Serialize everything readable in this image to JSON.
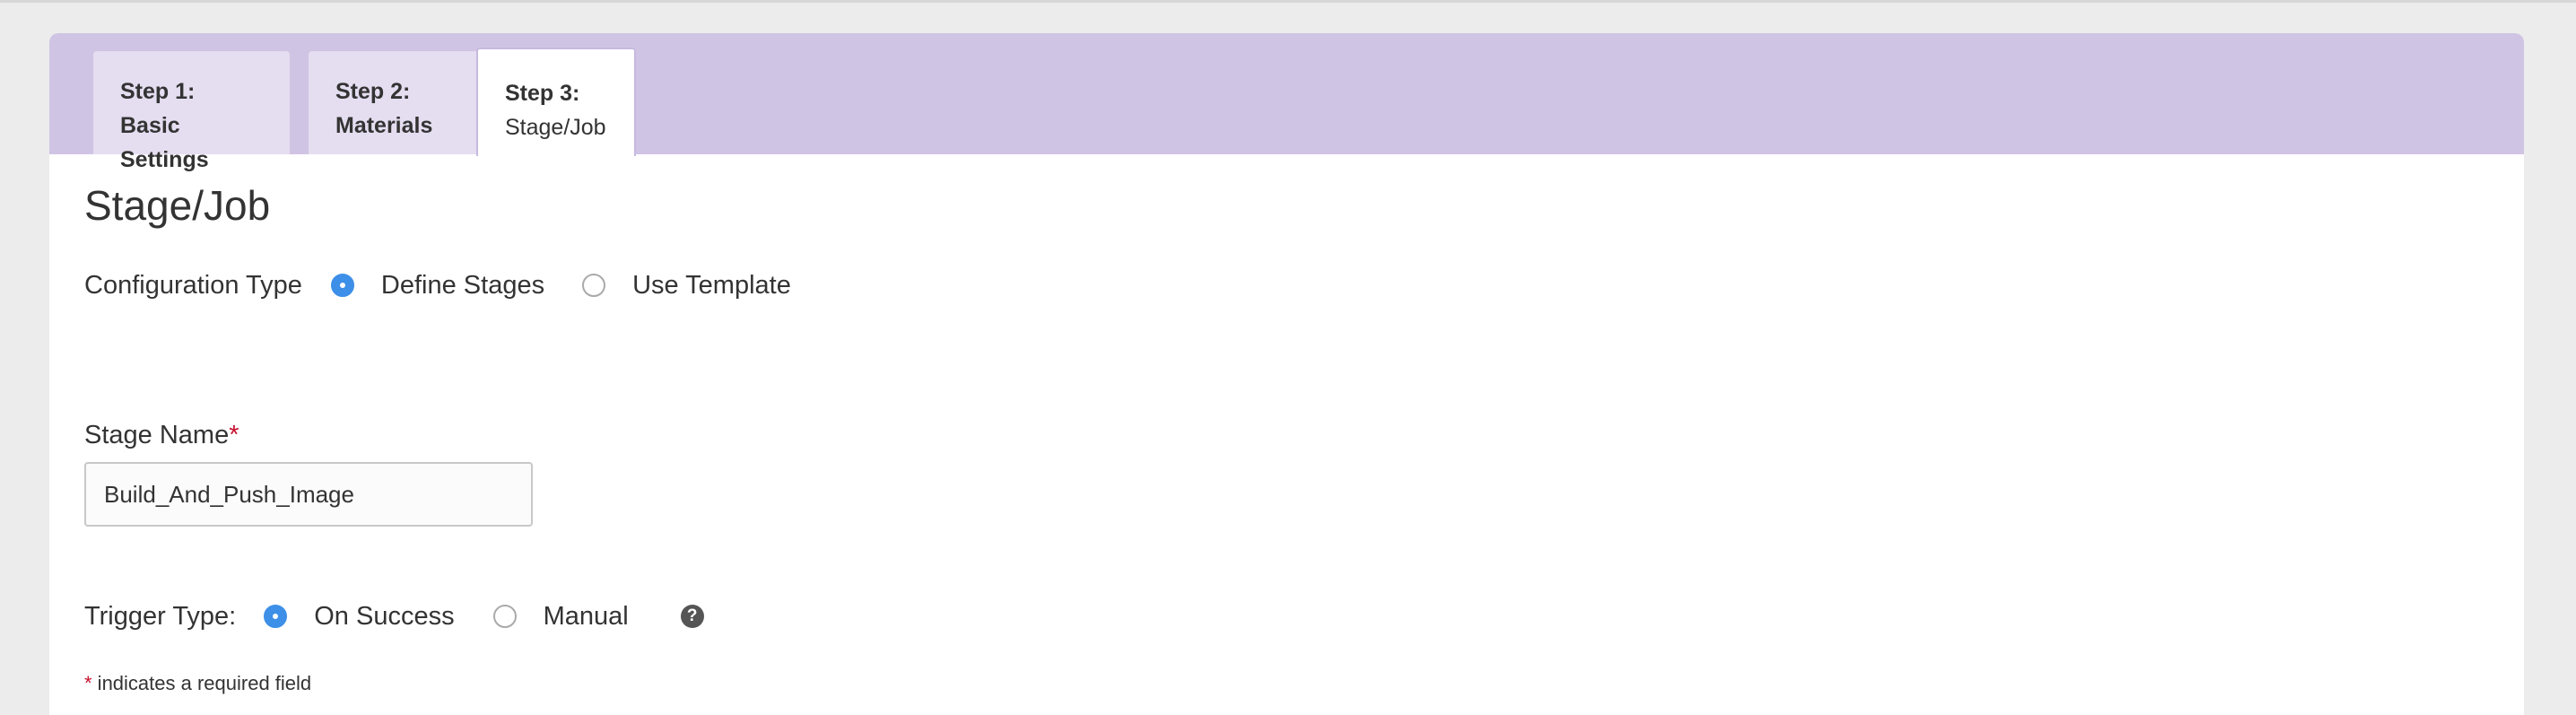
{
  "tabs": [
    {
      "step": "Step 1:",
      "name": "Basic Settings"
    },
    {
      "step": "Step 2:",
      "name": "Materials"
    },
    {
      "step": "Step 3:",
      "name": "Stage/Job"
    }
  ],
  "page_title": "Stage/Job",
  "configuration": {
    "label": "Configuration Type",
    "options": [
      "Define Stages",
      "Use Template"
    ],
    "selected": "Define Stages"
  },
  "stage_name": {
    "label": "Stage Name",
    "required_marker": "*",
    "value": "Build_And_Push_Image"
  },
  "trigger": {
    "label": "Trigger Type:",
    "options": [
      "On Success",
      "Manual"
    ],
    "selected": "On Success",
    "help_icon": "?"
  },
  "footnote": {
    "marker": "*",
    "text": " indicates a required field"
  },
  "colors": {
    "tabbar": "#d0c4e4",
    "radio_checked": "#3d8fe8",
    "required": "#c8102e"
  }
}
